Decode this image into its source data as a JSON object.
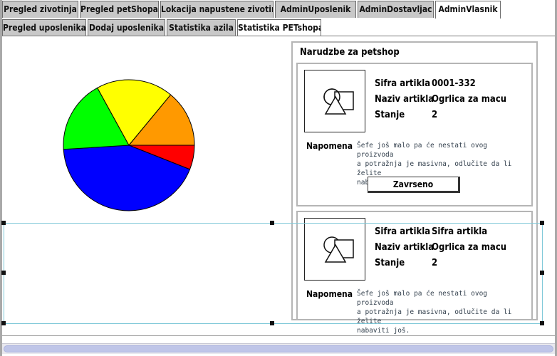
{
  "main_tabs": [
    {
      "label": "Pregled zivotinja",
      "active": false
    },
    {
      "label": "Pregled petShopa",
      "active": false
    },
    {
      "label": "Lokacija napustene zivotinje",
      "active": false
    },
    {
      "label": "AdminUposlenik",
      "active": false
    },
    {
      "label": "AdminDostavljac",
      "active": false
    },
    {
      "label": "AdminVlasnik",
      "active": true
    }
  ],
  "sub_tabs": [
    {
      "label": "Pregled uposlenika",
      "active": false
    },
    {
      "label": "Dodaj uposlenika",
      "active": false
    },
    {
      "label": "Statistika azila",
      "active": false
    },
    {
      "label": "Statistika PETshopa",
      "active": true
    }
  ],
  "chart_data": {
    "type": "pie",
    "slices": [
      {
        "color": "#ff0000",
        "value": 6
      },
      {
        "color": "#0000ff",
        "value": 43
      },
      {
        "color": "#00ff00",
        "value": 18
      },
      {
        "color": "#ffff00",
        "value": 19
      },
      {
        "color": "#ff9900",
        "value": 14
      }
    ],
    "start_angle_deg": 0,
    "direction": "clockwise"
  },
  "orders": {
    "title": "Narudzbe za petshop",
    "cards": [
      {
        "fields": [
          {
            "label": "Sifra artikla",
            "value": "0001-332"
          },
          {
            "label": "Naziv artikla",
            "value": "Ogrlica za macu"
          },
          {
            "label": "Stanje",
            "value": "2"
          }
        ],
        "note_label": "Napomena",
        "note_lines": [
          "Šefe još malo pa će nestati ovog proizvoda",
          "a potražnja je masivna, odlučite da li želite",
          "nabaviti još."
        ],
        "button_label": "Zavrseno"
      },
      {
        "fields": [
          {
            "label": "Sifra artikla",
            "value": "Sifra artikla"
          },
          {
            "label": "Naziv artikla",
            "value": "Ogrlica za macu"
          },
          {
            "label": "Stanje",
            "value": "2"
          }
        ],
        "note_label": "Napomena",
        "note_lines": [
          "Šefe još malo pa će nestati ovog proizvoda",
          "a potražnja je masivna, odlučite da li želite",
          "nabaviti još."
        ]
      }
    ]
  },
  "icons": {
    "product_image": "shapes-placeholder-icon"
  }
}
